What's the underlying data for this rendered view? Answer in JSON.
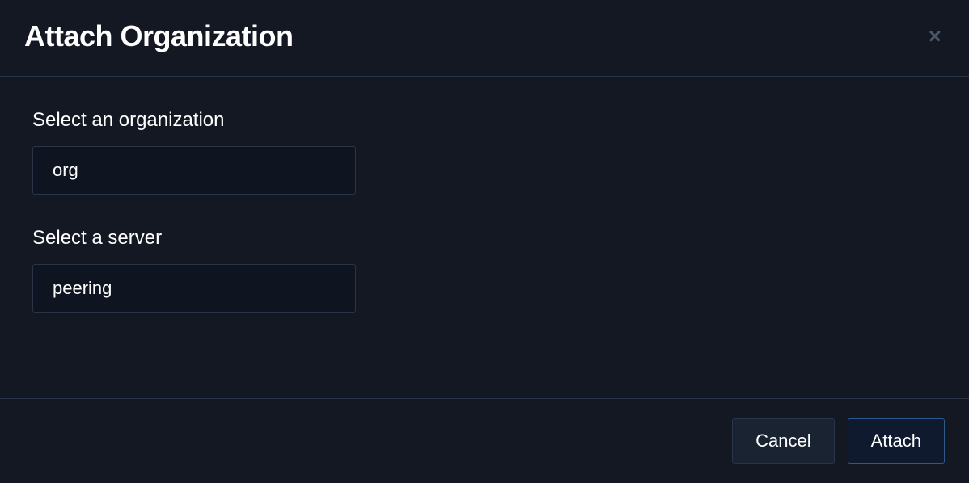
{
  "modal": {
    "title": "Attach Organization",
    "close_icon": "×"
  },
  "form": {
    "organization": {
      "label": "Select an organization",
      "value": "org"
    },
    "server": {
      "label": "Select a server",
      "value": "peering"
    }
  },
  "actions": {
    "cancel_label": "Cancel",
    "attach_label": "Attach"
  }
}
